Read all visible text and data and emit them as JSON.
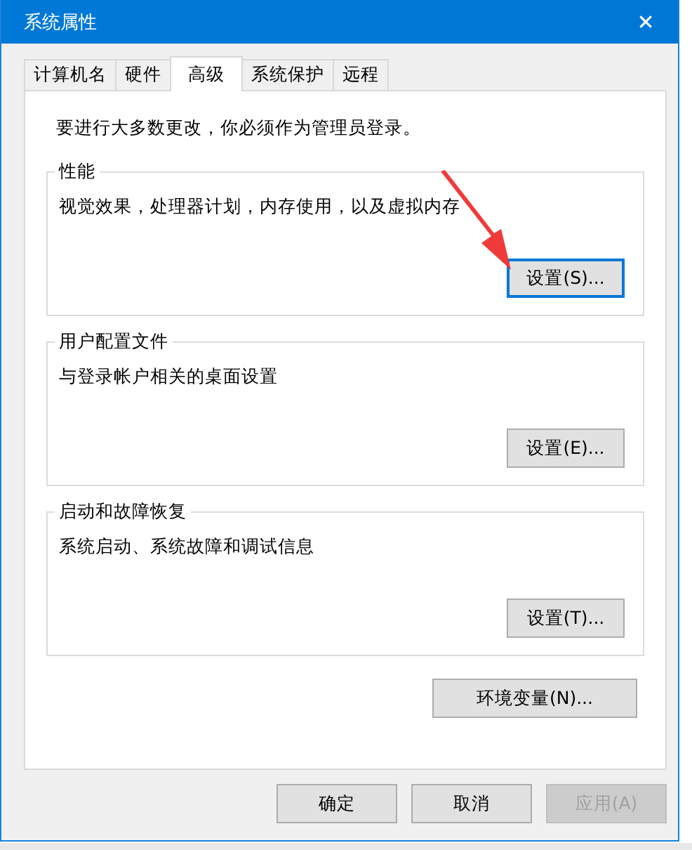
{
  "window": {
    "title": "系统属性",
    "close": "✕"
  },
  "tabs": [
    {
      "label": "计算机名",
      "selected": false
    },
    {
      "label": "硬件",
      "selected": false
    },
    {
      "label": "高级",
      "selected": true
    },
    {
      "label": "系统保护",
      "selected": false
    },
    {
      "label": "远程",
      "selected": false
    }
  ],
  "notice": "要进行大多数更改，你必须作为管理员登录。",
  "groups": [
    {
      "title": "性能",
      "description": "视觉效果，处理器计划，内存使用，以及虚拟内存",
      "button": {
        "label": "设置(S)...",
        "focused": true
      }
    },
    {
      "title": "用户配置文件",
      "description": "与登录帐户相关的桌面设置",
      "button": {
        "label": "设置(E)...",
        "focused": false
      }
    },
    {
      "title": "启动和故障恢复",
      "description": "系统启动、系统故障和调试信息",
      "button": {
        "label": "设置(T)...",
        "focused": false
      }
    }
  ],
  "env_button": {
    "label": "环境变量(N)...",
    "focused": false
  },
  "footer_buttons": [
    {
      "label": "确定",
      "disabled": false
    },
    {
      "label": "取消",
      "disabled": false
    },
    {
      "label": "应用(A)",
      "disabled": true
    }
  ]
}
